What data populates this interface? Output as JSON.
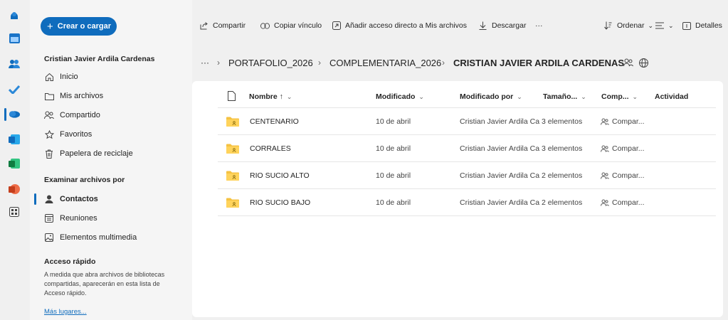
{
  "rail": {
    "icons": [
      "account-icon",
      "calendar-icon",
      "people-icon",
      "todo-icon",
      "onedrive-icon",
      "outlook-icon",
      "excel-icon",
      "powerpoint-icon",
      "apps-icon"
    ]
  },
  "sidebar": {
    "create_label": "Crear o cargar",
    "user_name": "Cristian Javier Ardila Cardenas",
    "nav": [
      {
        "label": "Inicio",
        "icon": "home-icon"
      },
      {
        "label": "Mis archivos",
        "icon": "folder-icon"
      },
      {
        "label": "Compartido",
        "icon": "people-icon"
      },
      {
        "label": "Favoritos",
        "icon": "star-icon"
      },
      {
        "label": "Papelera de reciclaje",
        "icon": "trash-icon"
      }
    ],
    "browse_heading": "Examinar archivos por",
    "browse": [
      {
        "label": "Contactos",
        "icon": "person-icon"
      },
      {
        "label": "Reuniones",
        "icon": "calendar-icon"
      },
      {
        "label": "Elementos multimedia",
        "icon": "image-icon"
      }
    ],
    "quick_heading": "Acceso rápido",
    "quick_text": "A medida que abra archivos de bibliotecas compartidas, aparecerán en esta lista de Acceso rápido.",
    "more_link": "Más lugares..."
  },
  "toolbar": {
    "share": "Compartir",
    "copy_link": "Copiar vínculo",
    "add_shortcut": "Añadir acceso directo a Mis archivos",
    "download": "Descargar",
    "more": "···",
    "sort": "Ordenar",
    "details": "Detalles"
  },
  "breadcrumb": {
    "ellipsis": "···",
    "items": [
      "PORTAFOLIO_2026",
      "COMPLEMENTARIA_2026"
    ],
    "current": "CRISTIAN JAVIER ARDILA CARDENAS"
  },
  "table": {
    "headers": {
      "name": "Nombre ↑",
      "modified": "Modificado",
      "modified_by": "Modificado por",
      "size": "Tamaño...",
      "sharing": "Comp...",
      "activity": "Actividad"
    },
    "rows": [
      {
        "name": "CENTENARIO",
        "modified": "10 de abril",
        "modified_by": "Cristian Javier Ardila Ca",
        "size": "3 elementos",
        "sharing": "Compar..."
      },
      {
        "name": "CORRALES",
        "modified": "10 de abril",
        "modified_by": "Cristian Javier Ardila Ca",
        "size": "3 elementos",
        "sharing": "Compar..."
      },
      {
        "name": "RIO SUCIO ALTO",
        "modified": "10 de abril",
        "modified_by": "Cristian Javier Ardila Ca",
        "size": "2 elementos",
        "sharing": "Compar..."
      },
      {
        "name": "RIO SUCIO BAJO",
        "modified": "10 de abril",
        "modified_by": "Cristian Javier Ardila Ca",
        "size": "2 elementos",
        "sharing": "Compar..."
      }
    ]
  },
  "colors": {
    "accent": "#0f6cbd",
    "folder": "#f5c242"
  }
}
